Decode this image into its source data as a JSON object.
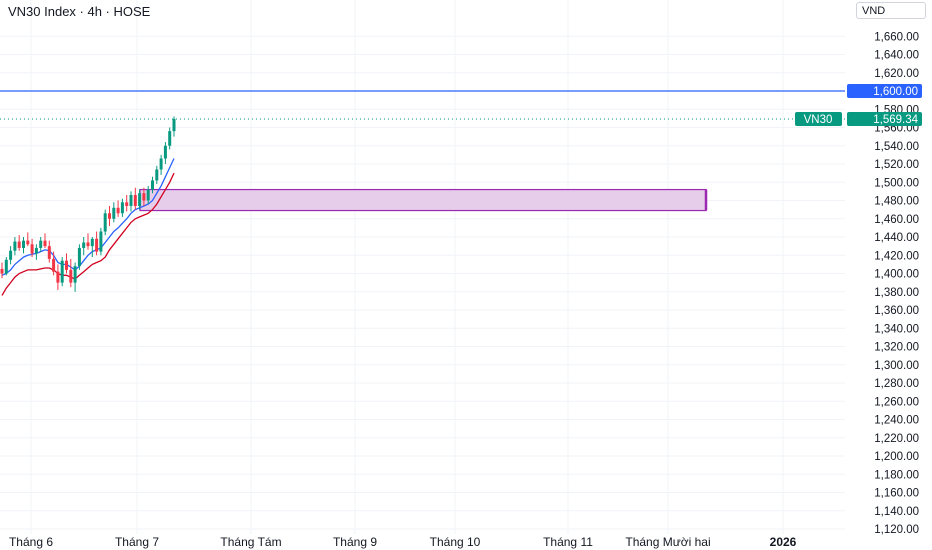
{
  "header": {
    "title": "VN30 Index · 4h · HOSE",
    "currency": "VND"
  },
  "colors": {
    "up": "#089981",
    "down": "#f23645",
    "blue_line": "#2962ff",
    "red_line": "#d1001f",
    "zone_fill": "#e6cdea",
    "zone_border": "#9c27b0",
    "price_line": "#089981"
  },
  "chart_data": {
    "type": "candlestick",
    "y_range": [
      1115,
      1668
    ],
    "y_ticks": [
      "1,660.00",
      "1,640.00",
      "1,620.00",
      "1,580.00",
      "1,560.00",
      "1,540.00",
      "1,520.00",
      "1,500.00",
      "1,480.00",
      "1,460.00",
      "1,440.00",
      "1,420.00",
      "1,400.00",
      "1,380.00",
      "1,360.00",
      "1,340.00",
      "1,320.00",
      "1,300.00",
      "1,280.00",
      "1,260.00",
      "1,240.00",
      "1,220.00",
      "1,200.00",
      "1,180.00",
      "1,160.00",
      "1,140.00",
      "1,120.00"
    ],
    "y_tick_values": [
      1660,
      1640,
      1620,
      1580,
      1560,
      1540,
      1520,
      1500,
      1480,
      1460,
      1440,
      1420,
      1400,
      1380,
      1360,
      1340,
      1320,
      1300,
      1280,
      1260,
      1240,
      1220,
      1200,
      1180,
      1160,
      1140,
      1120
    ],
    "x_labels": [
      {
        "label": "Tháng 6",
        "bold": false
      },
      {
        "label": "Tháng 7",
        "bold": false
      },
      {
        "label": "Tháng Tám",
        "bold": false
      },
      {
        "label": "Tháng 9",
        "bold": false
      },
      {
        "label": "Tháng 10",
        "bold": false
      },
      {
        "label": "Tháng 11",
        "bold": false
      },
      {
        "label": "Tháng Mười hai",
        "bold": false
      },
      {
        "label": "2026",
        "bold": true
      }
    ],
    "horizontal_level": {
      "value": 1600,
      "label": "1,600.00"
    },
    "last_price": {
      "symbol": "VN30",
      "value": 1569.34,
      "label": "1,569.34"
    },
    "zone": {
      "top": 1492,
      "bottom": 1469
    },
    "candles": [
      {
        "o": 1405,
        "h": 1412,
        "l": 1395,
        "c": 1400
      },
      {
        "o": 1400,
        "h": 1418,
        "l": 1398,
        "c": 1415
      },
      {
        "o": 1415,
        "h": 1430,
        "l": 1410,
        "c": 1425
      },
      {
        "o": 1425,
        "h": 1440,
        "l": 1420,
        "c": 1435
      },
      {
        "o": 1435,
        "h": 1442,
        "l": 1425,
        "c": 1428
      },
      {
        "o": 1428,
        "h": 1440,
        "l": 1422,
        "c": 1436
      },
      {
        "o": 1436,
        "h": 1445,
        "l": 1430,
        "c": 1432
      },
      {
        "o": 1432,
        "h": 1438,
        "l": 1418,
        "c": 1422
      },
      {
        "o": 1422,
        "h": 1432,
        "l": 1415,
        "c": 1428
      },
      {
        "o": 1428,
        "h": 1440,
        "l": 1424,
        "c": 1436
      },
      {
        "o": 1436,
        "h": 1444,
        "l": 1428,
        "c": 1430
      },
      {
        "o": 1430,
        "h": 1436,
        "l": 1412,
        "c": 1416
      },
      {
        "o": 1416,
        "h": 1424,
        "l": 1398,
        "c": 1402
      },
      {
        "o": 1402,
        "h": 1410,
        "l": 1382,
        "c": 1390
      },
      {
        "o": 1390,
        "h": 1418,
        "l": 1386,
        "c": 1414
      },
      {
        "o": 1414,
        "h": 1422,
        "l": 1400,
        "c": 1404
      },
      {
        "o": 1404,
        "h": 1416,
        "l": 1385,
        "c": 1390
      },
      {
        "o": 1390,
        "h": 1412,
        "l": 1380,
        "c": 1408
      },
      {
        "o": 1408,
        "h": 1432,
        "l": 1404,
        "c": 1428
      },
      {
        "o": 1428,
        "h": 1440,
        "l": 1420,
        "c": 1434
      },
      {
        "o": 1434,
        "h": 1444,
        "l": 1426,
        "c": 1430
      },
      {
        "o": 1430,
        "h": 1440,
        "l": 1418,
        "c": 1438
      },
      {
        "o": 1438,
        "h": 1446,
        "l": 1420,
        "c": 1424
      },
      {
        "o": 1424,
        "h": 1450,
        "l": 1420,
        "c": 1446
      },
      {
        "o": 1446,
        "h": 1470,
        "l": 1442,
        "c": 1466
      },
      {
        "o": 1466,
        "h": 1474,
        "l": 1452,
        "c": 1460
      },
      {
        "o": 1460,
        "h": 1478,
        "l": 1456,
        "c": 1472
      },
      {
        "o": 1472,
        "h": 1480,
        "l": 1462,
        "c": 1466
      },
      {
        "o": 1466,
        "h": 1482,
        "l": 1462,
        "c": 1478
      },
      {
        "o": 1478,
        "h": 1486,
        "l": 1468,
        "c": 1474
      },
      {
        "o": 1474,
        "h": 1490,
        "l": 1468,
        "c": 1486
      },
      {
        "o": 1486,
        "h": 1494,
        "l": 1470,
        "c": 1474
      },
      {
        "o": 1474,
        "h": 1492,
        "l": 1470,
        "c": 1488
      },
      {
        "o": 1488,
        "h": 1494,
        "l": 1474,
        "c": 1480
      },
      {
        "o": 1480,
        "h": 1496,
        "l": 1476,
        "c": 1492
      },
      {
        "o": 1492,
        "h": 1506,
        "l": 1488,
        "c": 1502
      },
      {
        "o": 1502,
        "h": 1518,
        "l": 1498,
        "c": 1514
      },
      {
        "o": 1514,
        "h": 1530,
        "l": 1508,
        "c": 1526
      },
      {
        "o": 1526,
        "h": 1544,
        "l": 1520,
        "c": 1540
      },
      {
        "o": 1540,
        "h": 1560,
        "l": 1536,
        "c": 1556
      },
      {
        "o": 1556,
        "h": 1572,
        "l": 1550,
        "c": 1569.34
      }
    ],
    "blue_series": [
      1398,
      1400,
      1404,
      1410,
      1414,
      1418,
      1420,
      1421,
      1422,
      1424,
      1426,
      1425,
      1420,
      1412,
      1410,
      1410,
      1407,
      1404,
      1408,
      1414,
      1420,
      1424,
      1426,
      1428,
      1434,
      1440,
      1446,
      1450,
      1455,
      1460,
      1466,
      1470,
      1472,
      1474,
      1476,
      1480,
      1488,
      1496,
      1506,
      1516,
      1526
    ],
    "red_series": [
      1376,
      1384,
      1390,
      1396,
      1400,
      1402,
      1404,
      1404,
      1404,
      1405,
      1406,
      1406,
      1404,
      1400,
      1398,
      1398,
      1396,
      1394,
      1398,
      1402,
      1406,
      1410,
      1412,
      1414,
      1418,
      1426,
      1432,
      1438,
      1444,
      1450,
      1456,
      1460,
      1462,
      1464,
      1466,
      1470,
      1476,
      1484,
      1492,
      1500,
      1510
    ]
  }
}
